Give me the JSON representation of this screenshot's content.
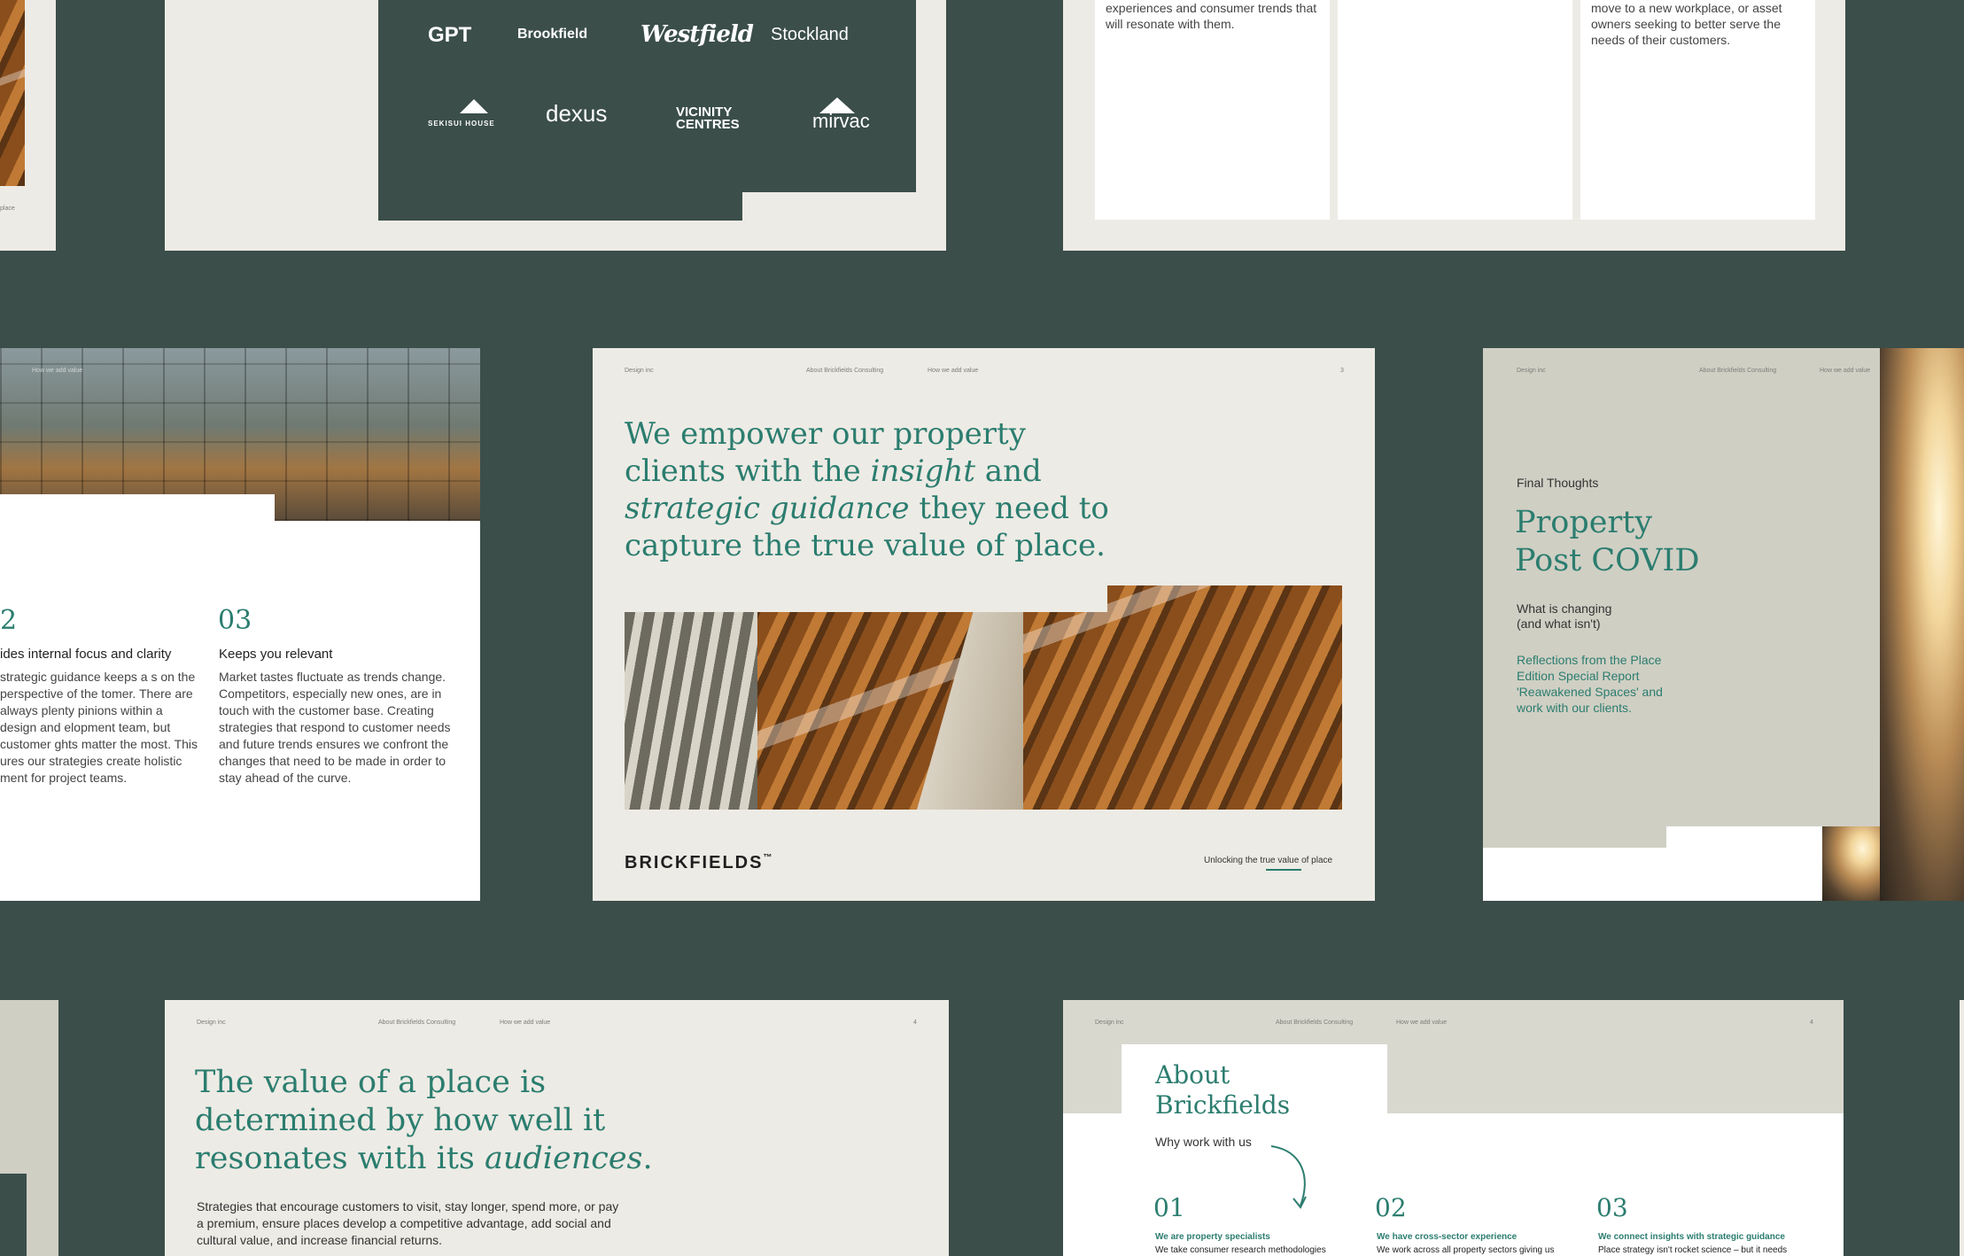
{
  "logos_slide": {
    "logos_row1": [
      "GPT",
      "Brookfield",
      "Westfield",
      "Stockland"
    ],
    "logos_row2": [
      "SEKISUI HOUSE",
      "dexus",
      "VICINITY CENTRES",
      "mirvac"
    ]
  },
  "columns_slide": {
    "col1_text": "experiences and consumer trends that will resonate with them.",
    "col3_text": "move to a new workplace, or asset owners seeking to better serve the needs of their customers."
  },
  "left_slide": {
    "header_text": "How we add value",
    "col2_number": "2",
    "col2_heading": "ides internal focus and clarity",
    "col2_body": "strategic guidance keeps a s on the perspective of the tomer. There are always plenty pinions within a design and elopment team, but customer ghts matter the most. This ures our strategies create holistic ment for project teams.",
    "col3_number": "03",
    "col3_heading": "Keeps you relevant",
    "col3_body": "Market tastes fluctuate as trends change. Competitors, especially new ones, are in touch with the customer base. Creating strategies that respond to customer needs and future trends ensures we confront the changes that need to be made in order to stay ahead of the curve."
  },
  "far_left_slide": {
    "caption": "place"
  },
  "center_slide": {
    "nav": [
      "Design inc",
      "About Brickfields Consulting",
      "How we add value",
      "3"
    ],
    "headline_1": "We empower our property",
    "headline_2a": "clients with the ",
    "headline_2b": "insight",
    "headline_2c": " and",
    "headline_3a": "strategic guidance",
    "headline_3b": " they need to",
    "headline_4": "capture the true value of place.",
    "brand": "BRICKFIELDS",
    "brand_mark": "™",
    "tagline": "Unlocking the true value of place"
  },
  "right_slide": {
    "nav": [
      "Design inc",
      "About Brickfields Consulting",
      "How we add value"
    ],
    "eyebrow": "Final Thoughts",
    "title_1": "Property",
    "title_2": "Post COVID",
    "sub_1": "What is changing",
    "sub_2": "(and what isn't)",
    "body": "Reflections from the Place Edition Special Report 'Reawakened Spaces' and work with our clients."
  },
  "bottom_left_slide": {
    "nav": [
      "Design inc",
      "About Brickfields Consulting",
      "How we add value",
      "4"
    ],
    "headline_1": "The value of a place is",
    "headline_2": "determined by how well it",
    "headline_3a": "resonates with its ",
    "headline_3b": "audiences",
    "headline_3c": ".",
    "body": "Strategies that encourage customers to visit, stay longer, spend more, or pay a premium, ensure places develop a competitive advantage, add social and cultural value, and increase financial returns."
  },
  "bottom_right_slide": {
    "nav": [
      "Design inc",
      "About Brickfields Consulting",
      "How we add value",
      "4"
    ],
    "title_1": "About",
    "title_2": "Brickfields",
    "subtitle": "Why work with us",
    "items": [
      {
        "number": "01",
        "heading": "We are property specialists",
        "body": "We take consumer research methodologies"
      },
      {
        "number": "02",
        "heading": "We have cross-sector experience",
        "body": "We work across all property sectors giving us"
      },
      {
        "number": "03",
        "heading": "We connect insights with strategic guidance",
        "body": "Place strategy isn't rocket science – but it needs"
      }
    ]
  },
  "colors": {
    "background": "#3b4e4a",
    "accent_green": "#2b7d6f",
    "paper": "#edebe5",
    "sage": "#d0cfc4"
  }
}
